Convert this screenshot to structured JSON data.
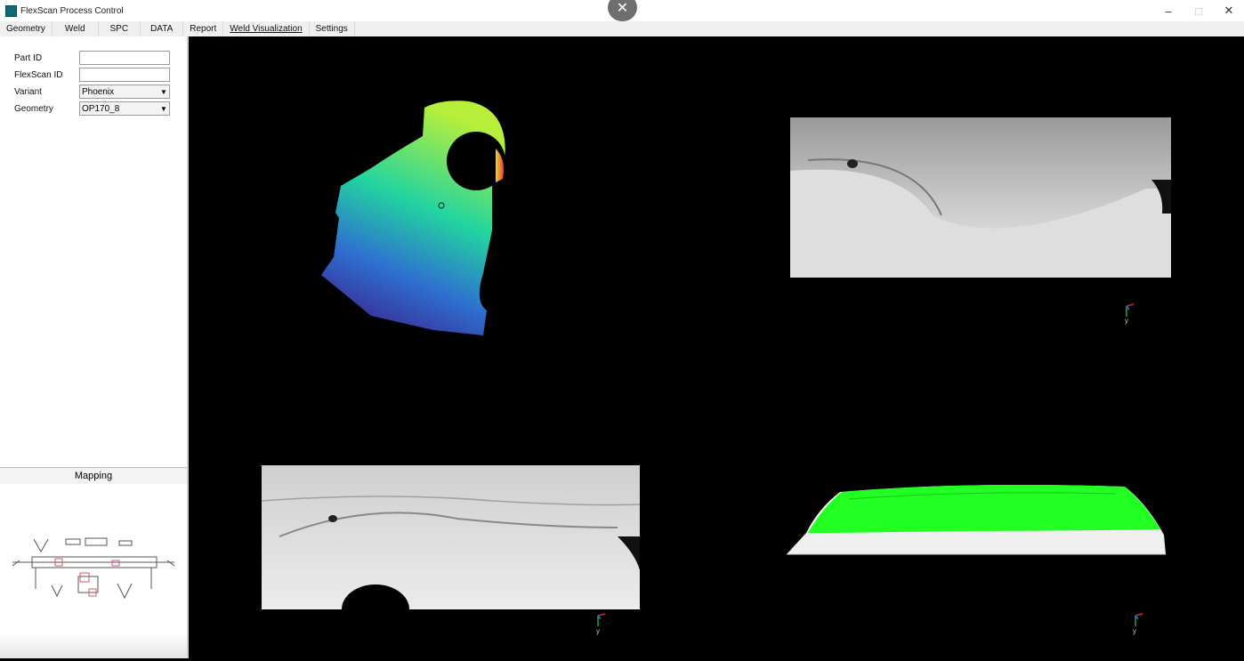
{
  "window": {
    "title": "FlexScan Process Control",
    "controls": [
      "–",
      "□",
      "✕"
    ],
    "overlay_close": "✕"
  },
  "menu": {
    "tabs": [
      "Geometry",
      "Weld",
      "SPC",
      "DATA",
      "Report",
      "Weld Visualization",
      "Settings"
    ],
    "active_tab": "Weld Visualization"
  },
  "form": {
    "part_id_label": "Part ID",
    "part_id_value": "",
    "flexscan_id_label": "FlexScan ID",
    "flexscan_id_value": "",
    "variant_label": "Variant",
    "variant_value": "Phoenix",
    "geometry_label": "Geometry",
    "geometry_value": "OP170_8"
  },
  "mapping": {
    "title": "Mapping"
  },
  "axes": {
    "label": "y"
  },
  "colors": {
    "depth_low": "#3b1f8a",
    "depth_mid": "#22d4a0",
    "depth_high": "#b8ef3a",
    "hot": "#e2482a",
    "weld_overlay": "#22ff22"
  }
}
